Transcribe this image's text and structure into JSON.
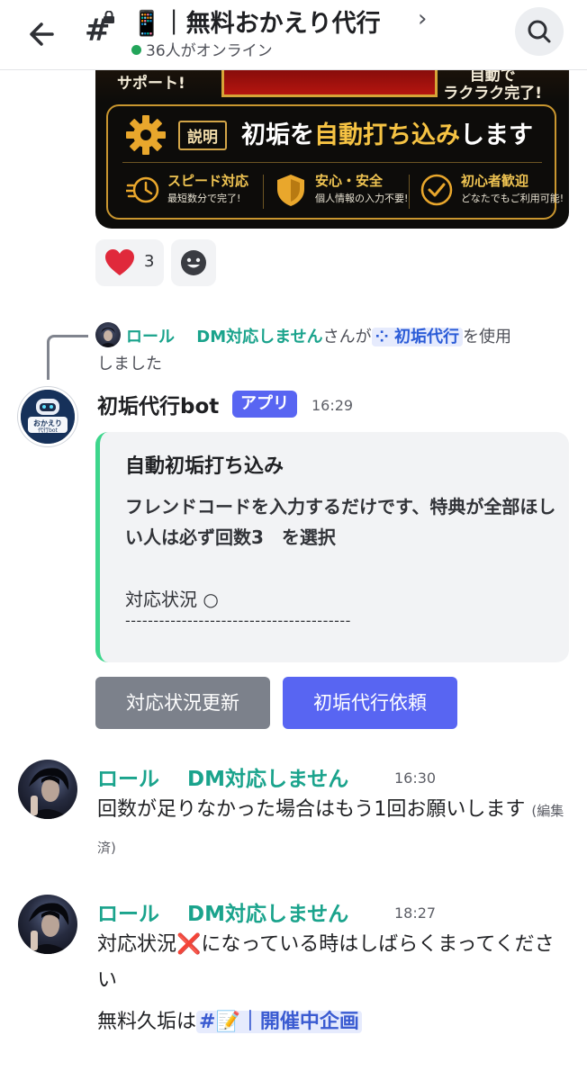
{
  "header": {
    "channel_title": "📱｜無料おかえり代行",
    "online_text": "36人がオンライン"
  },
  "banner": {
    "left_text": "サポート!",
    "right_text_1": "自動で",
    "right_text_2": "ラクラク完了!",
    "tag": "説明",
    "headline_pre": "初垢を",
    "headline_gold": "自動打ち込み",
    "headline_post": "します",
    "features": [
      {
        "title": "スピード対応",
        "sub": "最短数分で完了!"
      },
      {
        "title": "安心・安全",
        "sub": "個人情報の入力不要!"
      },
      {
        "title": "初心者歓迎",
        "sub": "どなたでもご利用可能!"
      }
    ]
  },
  "reactions": {
    "heart_count": "3"
  },
  "reply": {
    "user": "ロール　 DM対応しません",
    "mid": "さんが",
    "command": "初垢代行",
    "post": "を使用",
    "line2": "しました"
  },
  "bot_message": {
    "name": "初垢代行bot",
    "badge": "アプリ",
    "time": "16:29",
    "embed_title": "自動初垢打ち込み",
    "embed_desc": "フレンドコードを入力するだけです、特典が全部ほしい人は必ず回数3　を選択",
    "embed_status": "対応状況 ○",
    "embed_dashes": "----------------------------------------",
    "button_1": "対応状況更新",
    "button_2": "初垢代行依頼"
  },
  "messages": [
    {
      "name": "ロール　 DM対応しません",
      "time": "16:30",
      "text": "回数が足りなかった場合はもう1回お願いします",
      "edited": "(編集済)"
    },
    {
      "name": "ロール　 DM対応しません",
      "time": "18:27",
      "text_1": "対応状況❌になっている時はしばらくまってください",
      "text_2_pre": "無料久垢は",
      "text_2_link": "#📝｜開催中企画"
    }
  ]
}
